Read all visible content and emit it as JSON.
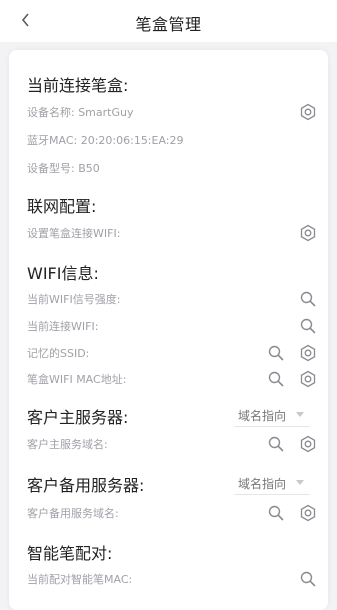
{
  "header": {
    "title": "笔盒管理"
  },
  "connected": {
    "title": "当前连接笔盒:",
    "device_name": "设备名称: SmartGuy",
    "bt_mac": "蓝牙MAC: 20:20:06:15:EA:29",
    "model": "设备型号: B50"
  },
  "network": {
    "title": "联网配置:",
    "set_wifi": "设置笔盒连接WIFI:"
  },
  "wifi": {
    "title": "WIFI信息:",
    "signal": "当前WIFI信号强度:",
    "current": "当前连接WIFI:",
    "ssid": "记忆的SSID:",
    "mac": "笔盒WIFI MAC地址:"
  },
  "primary_server": {
    "title": "客户主服务器:",
    "select_value": "域名指向",
    "domain": "客户主服务域名:"
  },
  "backup_server": {
    "title": "客户备用服务器:",
    "select_value": "域名指向",
    "domain": "客户备用服务域名:"
  },
  "pen": {
    "title": "智能笔配对:",
    "current_mac": "当前配对智能笔MAC:"
  },
  "icons": {
    "back": "chevron-left-icon",
    "settings": "gear-icon",
    "search": "search-icon"
  },
  "colors": {
    "background": "#f3f3f5",
    "card": "#ffffff",
    "label": "#a0a0a8",
    "icon": "#8a8a92"
  }
}
